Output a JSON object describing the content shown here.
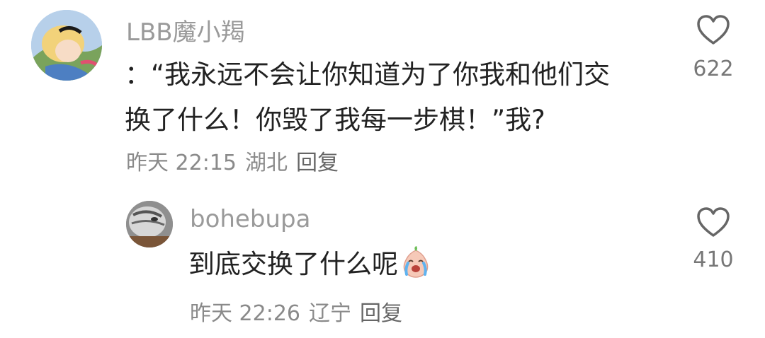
{
  "comments": [
    {
      "username": "LBB魔小羯",
      "text_line1": "：“我永远不会让你知道为了你我和他们交",
      "text_line2": "换了什么！你毁了我每一步棋！”我?",
      "time": "昨天 22:15",
      "location": "湖北",
      "reply_label": "回复",
      "likes": "622",
      "avatar_icon": "cartoon-girl-avatar-icon"
    },
    {
      "username": "bohebupa",
      "text": "到底交换了什么呢",
      "emoji_icon": "crying-peach-emoji-icon",
      "time": "昨天 22:26",
      "location": "辽宁",
      "reply_label": "回复",
      "likes": "410",
      "avatar_icon": "cat-avatar-icon"
    }
  ],
  "colors": {
    "username": "#9a9a9a",
    "text": "#222222",
    "meta": "#8a8a8a",
    "like_count": "#777777"
  }
}
